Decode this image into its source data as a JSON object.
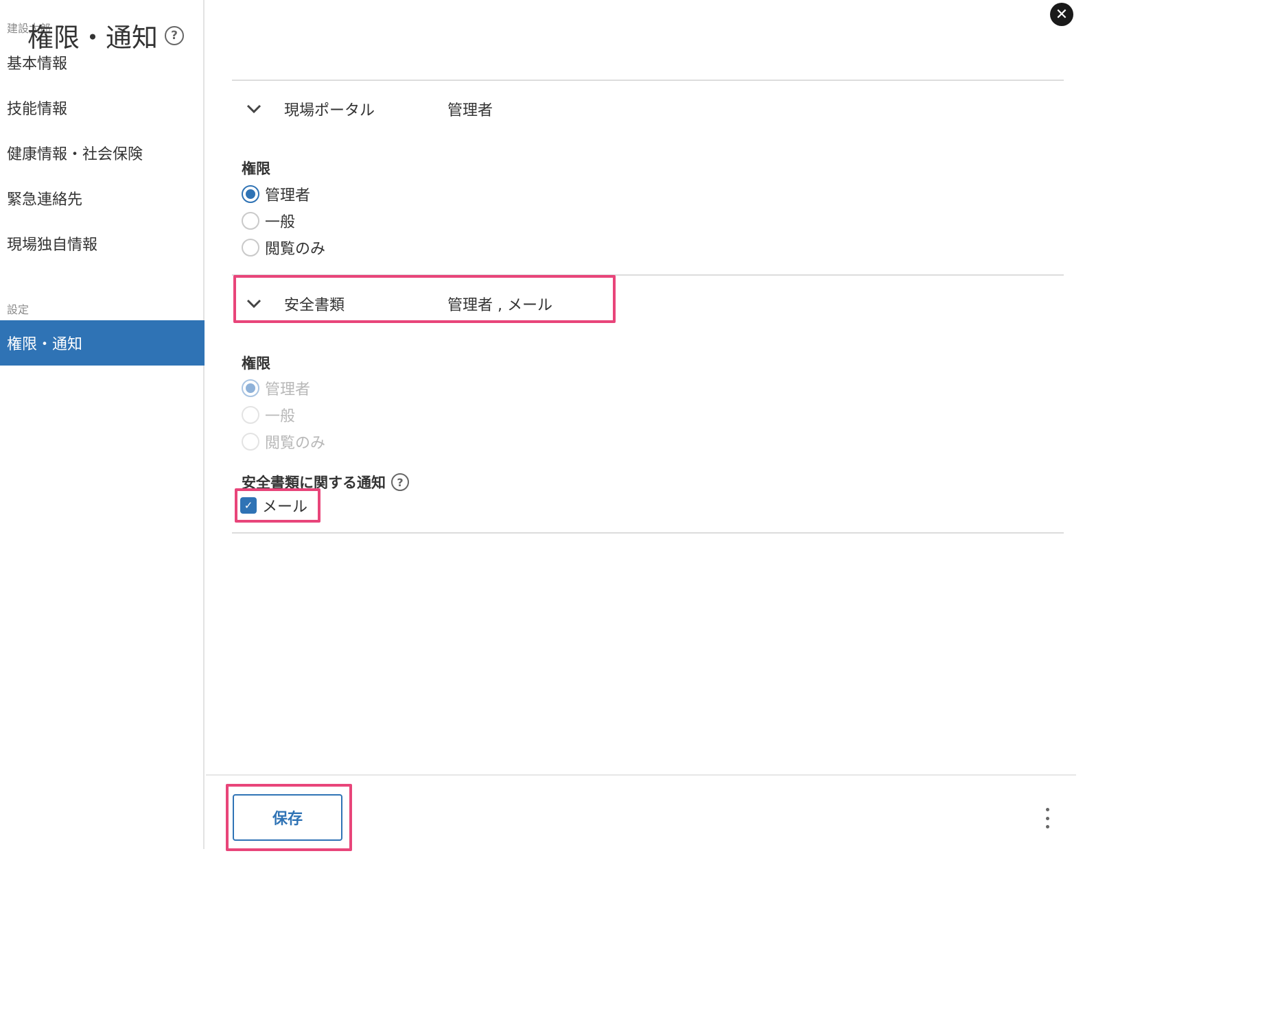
{
  "sidebar": {
    "user_name": "建設太郎",
    "items": [
      {
        "label": "基本情報"
      },
      {
        "label": "技能情報"
      },
      {
        "label": "健康情報・社会保険"
      },
      {
        "label": "緊急連絡先"
      },
      {
        "label": "現場独自情報"
      }
    ],
    "settings_section": "設定",
    "settings_items": [
      {
        "label": "権限・通知",
        "active": true
      }
    ]
  },
  "page": {
    "title": "権限・通知",
    "help_icon": "?",
    "close_icon": "✕"
  },
  "accordions": [
    {
      "name": "現場ポータル",
      "summary": "管理者",
      "permission_label": "権限",
      "options": [
        "管理者",
        "一般",
        "閲覧のみ"
      ],
      "selected": "管理者",
      "disabled": false
    },
    {
      "name": "安全書類",
      "summary": "管理者 , メール",
      "permission_label": "権限",
      "options": [
        "管理者",
        "一般",
        "閲覧のみ"
      ],
      "selected": "管理者",
      "disabled": true,
      "notification_label": "安全書類に関する通知",
      "notification_help": "?",
      "notification_option": "メール",
      "notification_checked": true
    }
  ],
  "footer": {
    "save_label": "保存"
  },
  "colors": {
    "accent": "#2f73b5",
    "highlight": "#e8457a"
  }
}
